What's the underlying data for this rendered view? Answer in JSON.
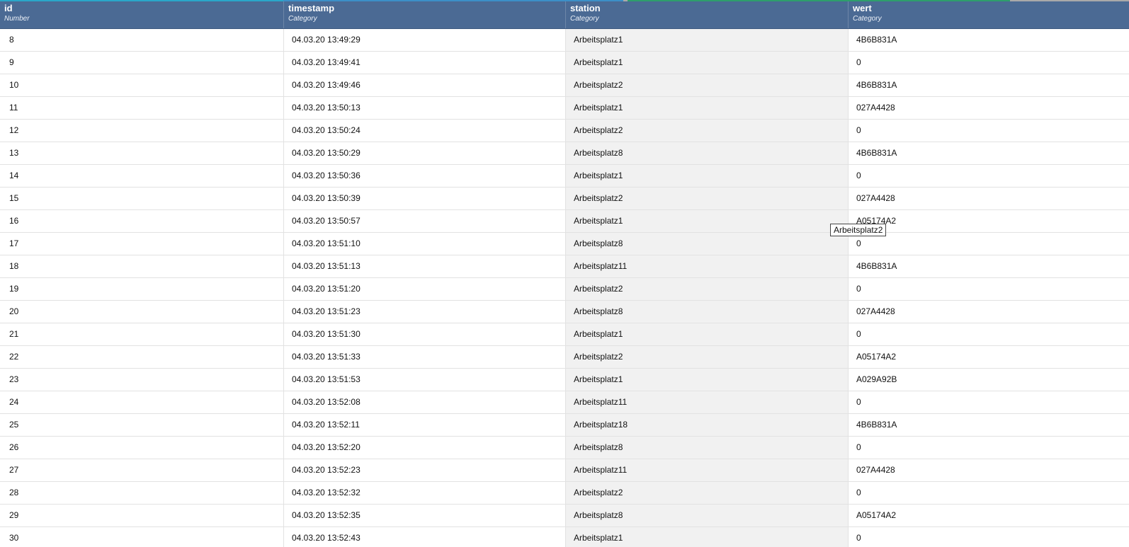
{
  "colors": {
    "header_bg": "#4b6a94",
    "header_text": "#ffffff",
    "station_column_bg": "#f1f1f1",
    "accent_segments": [
      "#2aa7c9",
      "#3c8fc7",
      "#a9a9a9",
      "#2e9e6c",
      "#a9a9a9"
    ]
  },
  "table": {
    "columns": [
      {
        "name": "id",
        "type": "Number"
      },
      {
        "name": "timestamp",
        "type": "Category"
      },
      {
        "name": "station",
        "type": "Category"
      },
      {
        "name": "wert",
        "type": "Category"
      }
    ],
    "rows": [
      [
        "8",
        "04.03.20 13:49:29",
        "Arbeitsplatz1",
        "4B6B831A"
      ],
      [
        "9",
        "04.03.20 13:49:41",
        "Arbeitsplatz1",
        "0"
      ],
      [
        "10",
        "04.03.20 13:49:46",
        "Arbeitsplatz2",
        "4B6B831A"
      ],
      [
        "11",
        "04.03.20 13:50:13",
        "Arbeitsplatz1",
        "027A4428"
      ],
      [
        "12",
        "04.03.20 13:50:24",
        "Arbeitsplatz2",
        "0"
      ],
      [
        "13",
        "04.03.20 13:50:29",
        "Arbeitsplatz8",
        "4B6B831A"
      ],
      [
        "14",
        "04.03.20 13:50:36",
        "Arbeitsplatz1",
        "0"
      ],
      [
        "15",
        "04.03.20 13:50:39",
        "Arbeitsplatz2",
        "027A4428"
      ],
      [
        "16",
        "04.03.20 13:50:57",
        "Arbeitsplatz1",
        "A05174A2"
      ],
      [
        "17",
        "04.03.20 13:51:10",
        "Arbeitsplatz8",
        "0"
      ],
      [
        "18",
        "04.03.20 13:51:13",
        "Arbeitsplatz11",
        "4B6B831A"
      ],
      [
        "19",
        "04.03.20 13:51:20",
        "Arbeitsplatz2",
        "0"
      ],
      [
        "20",
        "04.03.20 13:51:23",
        "Arbeitsplatz8",
        "027A4428"
      ],
      [
        "21",
        "04.03.20 13:51:30",
        "Arbeitsplatz1",
        "0"
      ],
      [
        "22",
        "04.03.20 13:51:33",
        "Arbeitsplatz2",
        "A05174A2"
      ],
      [
        "23",
        "04.03.20 13:51:53",
        "Arbeitsplatz1",
        "A029A92B"
      ],
      [
        "24",
        "04.03.20 13:52:08",
        "Arbeitsplatz11",
        "0"
      ],
      [
        "25",
        "04.03.20 13:52:11",
        "Arbeitsplatz18",
        "4B6B831A"
      ],
      [
        "26",
        "04.03.20 13:52:20",
        "Arbeitsplatz8",
        "0"
      ],
      [
        "27",
        "04.03.20 13:52:23",
        "Arbeitsplatz11",
        "027A4428"
      ],
      [
        "28",
        "04.03.20 13:52:32",
        "Arbeitsplatz2",
        "0"
      ],
      [
        "29",
        "04.03.20 13:52:35",
        "Arbeitsplatz8",
        "A05174A2"
      ],
      [
        "30",
        "04.03.20 13:52:43",
        "Arbeitsplatz1",
        "0"
      ]
    ]
  },
  "tooltip": {
    "text": "Arbeitsplatz2"
  }
}
